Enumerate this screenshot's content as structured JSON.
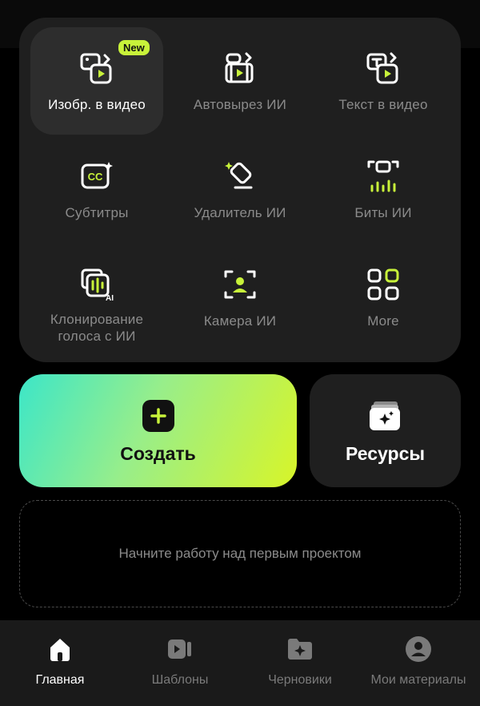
{
  "tools": [
    {
      "label": "Изобр. в видео",
      "icon": "image-to-video-icon",
      "badge": "New"
    },
    {
      "label": "Автовырез ИИ",
      "icon": "auto-cutout-icon"
    },
    {
      "label": "Текст  в видео",
      "icon": "text-to-video-icon"
    },
    {
      "label": "Субтитры",
      "icon": "captions-cc-icon"
    },
    {
      "label": "Удалитель ИИ",
      "icon": "eraser-icon"
    },
    {
      "label": "Биты ИИ",
      "icon": "beats-icon"
    },
    {
      "label": "Клонирование голоса с ИИ",
      "icon": "voice-clone-icon"
    },
    {
      "label": "Камера ИИ",
      "icon": "ai-camera-icon"
    },
    {
      "label": "More",
      "icon": "more-grid-icon"
    }
  ],
  "actions": {
    "create_label": "Создать",
    "resources_label": "Ресурсы"
  },
  "empty_state": {
    "text": "Начните работу над первым проектом"
  },
  "nav": [
    {
      "label": "Главная",
      "icon": "home-icon",
      "active": true
    },
    {
      "label": "Шаблоны",
      "icon": "templates-icon"
    },
    {
      "label": "Черновики",
      "icon": "drafts-folder-icon"
    },
    {
      "label": "Мои материалы",
      "icon": "profile-icon"
    }
  ],
  "colors": {
    "accent": "#c8f23a",
    "gradient_start": "#3ce6c8",
    "gradient_end": "#d8f528",
    "panel": "#1f1f1f",
    "background": "#000000"
  }
}
